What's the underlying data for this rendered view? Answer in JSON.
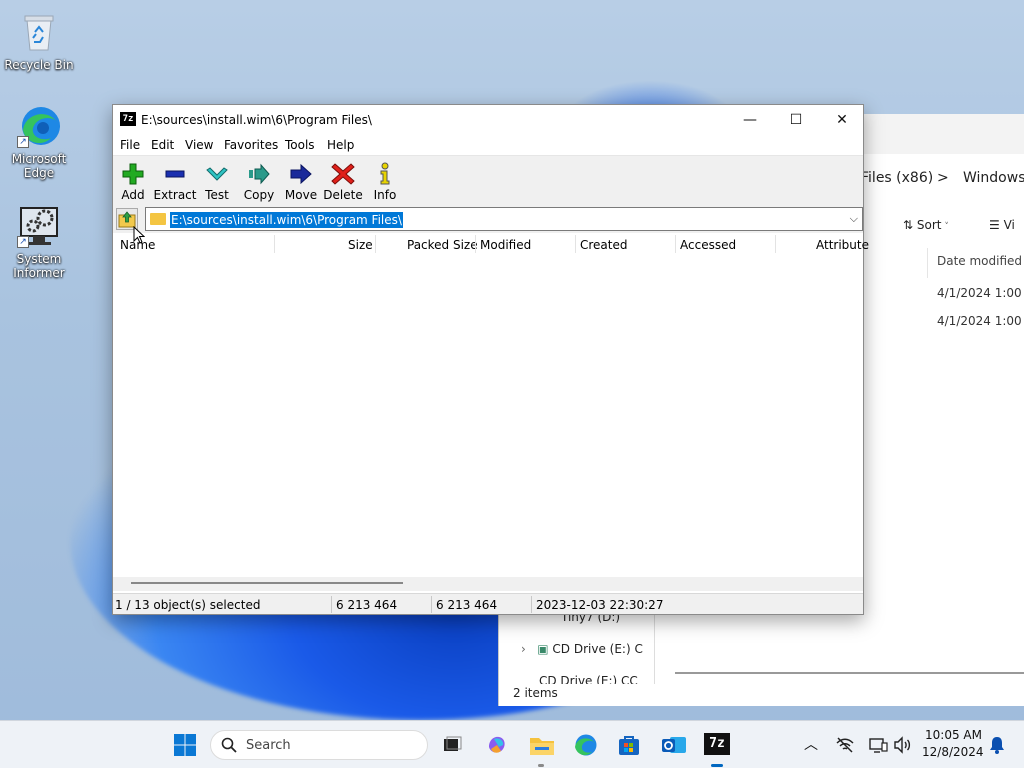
{
  "desktop": {
    "icons": [
      {
        "label": "Recycle Bin"
      },
      {
        "label": "Microsoft Edge"
      },
      {
        "label": "System Informer"
      }
    ]
  },
  "explorer_bg": {
    "breadcrumb_1": "Files (x86)",
    "breadcrumb_sep": ">",
    "breadcrumb_2": "Windows",
    "sort_label": "Sort",
    "view_label": "Vi",
    "column_date_modified": "Date modified",
    "rows": [
      "4/1/2024 1:00 AM",
      "4/1/2024 1:00 AM"
    ],
    "tree": [
      "Tiny7 (D:)",
      "CD Drive (E:) C",
      "CD Drive (E:) CC"
    ],
    "status": "2 items"
  },
  "window": {
    "title": "E:\\sources\\install.wim\\6\\Program Files\\",
    "app_icon": "7z",
    "controls": {
      "minimize": "—",
      "maximize": "☐",
      "close": "✕"
    },
    "menu": [
      "File",
      "Edit",
      "View",
      "Favorites",
      "Tools",
      "Help"
    ],
    "toolbar": [
      "Add",
      "Extract",
      "Test",
      "Copy",
      "Move",
      "Delete",
      "Info"
    ],
    "address": "E:\\sources\\install.wim\\6\\Program Files\\",
    "columns": [
      "Name",
      "Size",
      "Packed Size",
      "Modified",
      "Created",
      "Accessed",
      "Attribute"
    ],
    "status": {
      "selected": "1 / 13 object(s) selected",
      "size": "6 213 464",
      "packed": "6 213 464",
      "date": "2023-12-03 22:30:27"
    }
  },
  "taskbar": {
    "search_placeholder": "Search",
    "time": "10:05 AM",
    "date": "12/8/2024",
    "sevenzip_label": "7z"
  },
  "colors": {
    "accent": "#0078d7",
    "add_green": "#22aa22",
    "extract_blue": "#1a2fb0",
    "delete_red": "#e0201a",
    "info_yellow": "#e8d400"
  }
}
